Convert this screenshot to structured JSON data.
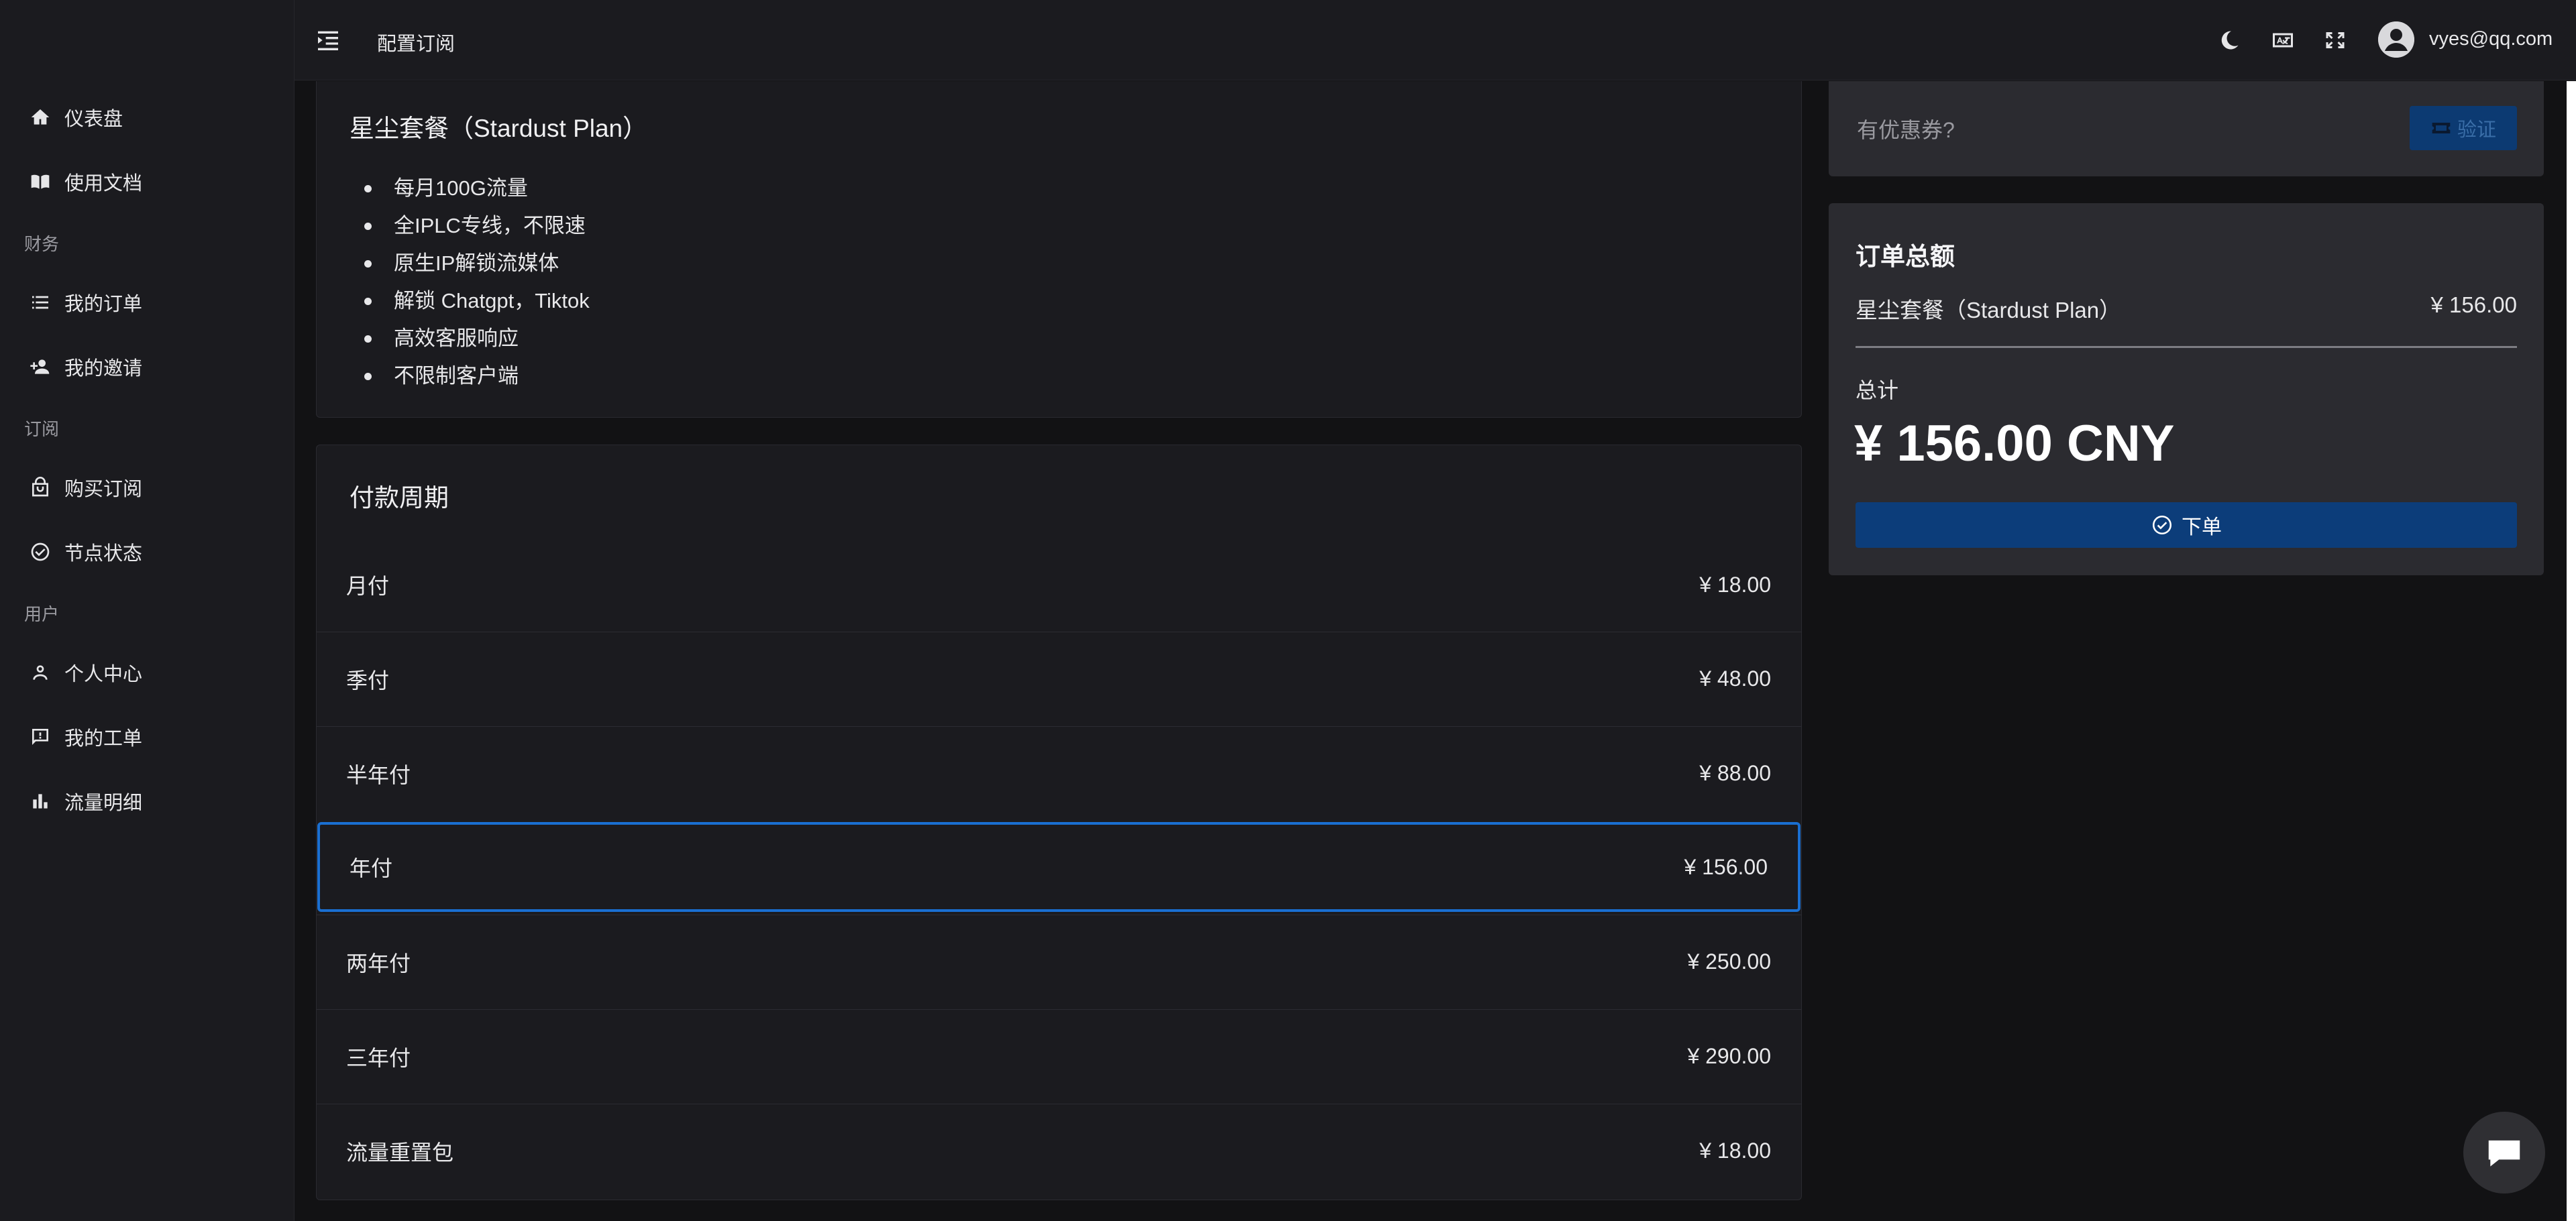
{
  "header": {
    "page_title": "配置订阅",
    "user_email": "vyes@qq.com"
  },
  "sidebar": {
    "items": [
      {
        "label": "仪表盘",
        "icon": "home-icon"
      },
      {
        "label": "使用文档",
        "icon": "book-icon"
      },
      {
        "label": "我的订单",
        "icon": "list-icon"
      },
      {
        "label": "我的邀请",
        "icon": "user-add-icon"
      },
      {
        "label": "购买订阅",
        "icon": "shopping-bag-icon"
      },
      {
        "label": "节点状态",
        "icon": "check-circle-icon"
      },
      {
        "label": "个人中心",
        "icon": "person-icon"
      },
      {
        "label": "我的工单",
        "icon": "ticket-chat-icon"
      },
      {
        "label": "流量明细",
        "icon": "bar-chart-icon"
      }
    ],
    "groups": {
      "finance": "财务",
      "subscription": "订阅",
      "user": "用户"
    }
  },
  "plan": {
    "title": "星尘套餐（Stardust Plan）",
    "features": [
      "每月100G流量",
      "全IPLC专线，不限速",
      "原生IP解锁流媒体",
      "解锁 Chatgpt，Tiktok",
      "高效客服响应",
      "不限制客户端"
    ]
  },
  "payment": {
    "title": "付款周期",
    "periods": [
      {
        "name": "月付",
        "price": "¥ 18.00",
        "selected": false
      },
      {
        "name": "季付",
        "price": "¥ 48.00",
        "selected": false
      },
      {
        "name": "半年付",
        "price": "¥ 88.00",
        "selected": false
      },
      {
        "name": "年付",
        "price": "¥ 156.00",
        "selected": true
      },
      {
        "name": "两年付",
        "price": "¥ 250.00",
        "selected": false
      },
      {
        "name": "三年付",
        "price": "¥ 290.00",
        "selected": false
      },
      {
        "name": "流量重置包",
        "price": "¥ 18.00",
        "selected": false
      }
    ]
  },
  "coupon": {
    "placeholder": "有优惠券?",
    "verify_label": "验证"
  },
  "summary": {
    "title": "订单总额",
    "item_name": "星尘套餐（Stardust Plan）",
    "item_price": "¥ 156.00",
    "total_label": "总计",
    "total_value": "¥ 156.00 CNY",
    "order_button": "下单"
  },
  "colors": {
    "accent": "#1a6fd1",
    "button_bg": "#0c3d7a",
    "background": "#121214",
    "panel": "#1b1b1f",
    "summary_panel": "#2b2b30"
  }
}
